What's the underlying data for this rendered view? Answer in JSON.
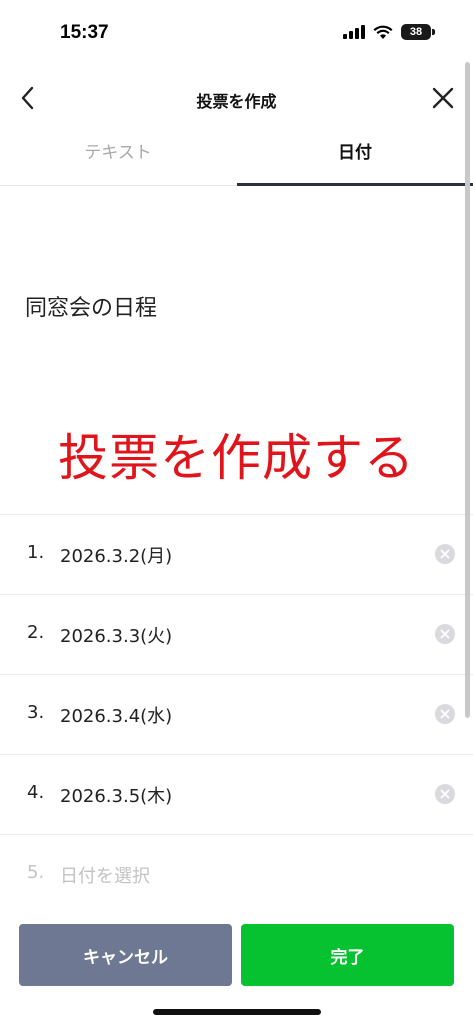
{
  "status_bar": {
    "time": "15:37",
    "battery": "38",
    "icons": [
      "cellular-signal-icon",
      "wifi-icon",
      "battery-icon"
    ]
  },
  "header": {
    "title": "投票を作成",
    "back_icon": "chevron-left-icon",
    "close_icon": "close-icon"
  },
  "tabs": [
    {
      "label": "テキスト",
      "selected": false
    },
    {
      "label": "日付",
      "selected": true
    }
  ],
  "question": "同窓会の日程",
  "overlay_text": "投票を作成する",
  "options": [
    {
      "number": "1.",
      "value": "2026.3.2(月)"
    },
    {
      "number": "2.",
      "value": "2026.3.3(火)"
    },
    {
      "number": "3.",
      "value": "2026.3.4(水)"
    },
    {
      "number": "4.",
      "value": "2026.3.5(木)"
    }
  ],
  "new_option": {
    "number": "5.",
    "placeholder": "日付を選択"
  },
  "buttons": {
    "cancel": "キャンセル",
    "done": "完了"
  },
  "colors": {
    "accent_green": "#06c130",
    "cancel_gray": "#6f7893",
    "overlay_red": "#e0141b"
  }
}
